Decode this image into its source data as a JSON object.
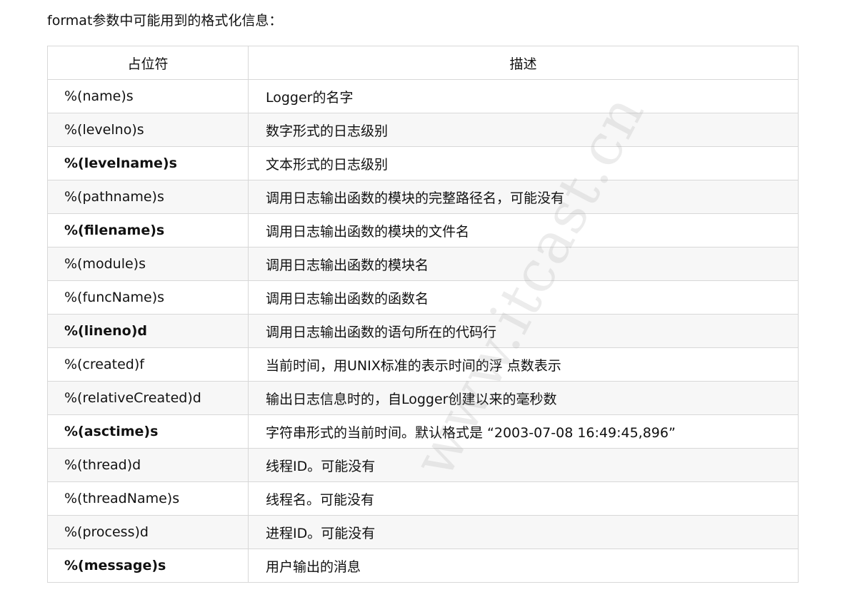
{
  "intro": "format参数中可能用到的格式化信息：",
  "table": {
    "headers": {
      "placeholder": "占位符",
      "description": "描述"
    },
    "rows": [
      {
        "placeholder": "%(name)s",
        "description": "Logger的名字",
        "bold": false
      },
      {
        "placeholder": "%(levelno)s",
        "description": "数字形式的日志级别",
        "bold": false
      },
      {
        "placeholder": "%(levelname)s",
        "description": "文本形式的日志级别",
        "bold": true
      },
      {
        "placeholder": "%(pathname)s",
        "description": "调用日志输出函数的模块的完整路径名，可能没有",
        "bold": false
      },
      {
        "placeholder": "%(filename)s",
        "description": "调用日志输出函数的模块的文件名",
        "bold": true
      },
      {
        "placeholder": "%(module)s",
        "description": "调用日志输出函数的模块名",
        "bold": false
      },
      {
        "placeholder": "%(funcName)s",
        "description": "调用日志输出函数的函数名",
        "bold": false
      },
      {
        "placeholder": "%(lineno)d",
        "description": "调用日志输出函数的语句所在的代码行",
        "bold": true
      },
      {
        "placeholder": "%(created)f",
        "description": "当前时间，用UNIX标准的表示时间的浮 点数表示",
        "bold": false
      },
      {
        "placeholder": "%(relativeCreated)d",
        "description": "输出日志信息时的，自Logger创建以来的毫秒数",
        "bold": false
      },
      {
        "placeholder": "%(asctime)s",
        "description": "字符串形式的当前时间。默认格式是 “2003-07-08 16:49:45,896”",
        "bold": true
      },
      {
        "placeholder": "%(thread)d",
        "description": "线程ID。可能没有",
        "bold": false
      },
      {
        "placeholder": "%(threadName)s",
        "description": "线程名。可能没有",
        "bold": false
      },
      {
        "placeholder": "%(process)d",
        "description": "进程ID。可能没有",
        "bold": false
      },
      {
        "placeholder": "%(message)s",
        "description": "用户输出的消息",
        "bold": true
      }
    ]
  },
  "watermark": "www.itcast.cn"
}
